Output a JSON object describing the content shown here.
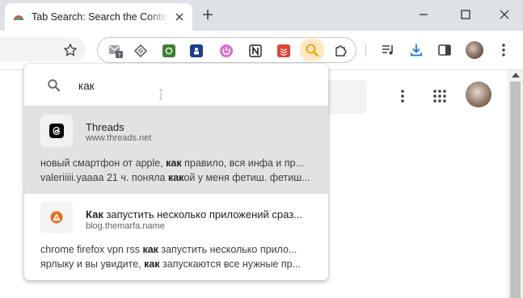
{
  "tab": {
    "title": "Tab Search: Search the Content"
  },
  "search": {
    "query": "как"
  },
  "results": [
    {
      "title_pre": "",
      "title_bold": "",
      "title_rest": "Threads",
      "url": "www.threads.net",
      "snippets": [
        {
          "pre": "новый смартфон от apple, ",
          "bold": "как",
          "post": " правило, вся инфа и пр..."
        },
        {
          "pre": "valeriiiii.yaaaa 21 ч. поняла ",
          "bold": "как",
          "post": "ой у меня фетиш. фетиш..."
        }
      ],
      "icon": "threads-logo-icon",
      "selected": true
    },
    {
      "title_pre": "",
      "title_bold": "Как",
      "title_rest": " запустить несколько приложений сраз...",
      "url": "blog.themarfa.name",
      "snippets": [
        {
          "pre": "chrome firefox vpn rss ",
          "bold": "как",
          "post": " запустить несколько прило..."
        },
        {
          "pre": "ярлыку и вы увидите, ",
          "bold": "как",
          "post": " запускаются все нужные пр..."
        }
      ],
      "icon": "marfa-logo-icon",
      "selected": false
    }
  ],
  "colors": {
    "accent_orange": "#f4a300",
    "selected_row": "#e2e2e2",
    "tabstrip": "#dee1e6"
  }
}
